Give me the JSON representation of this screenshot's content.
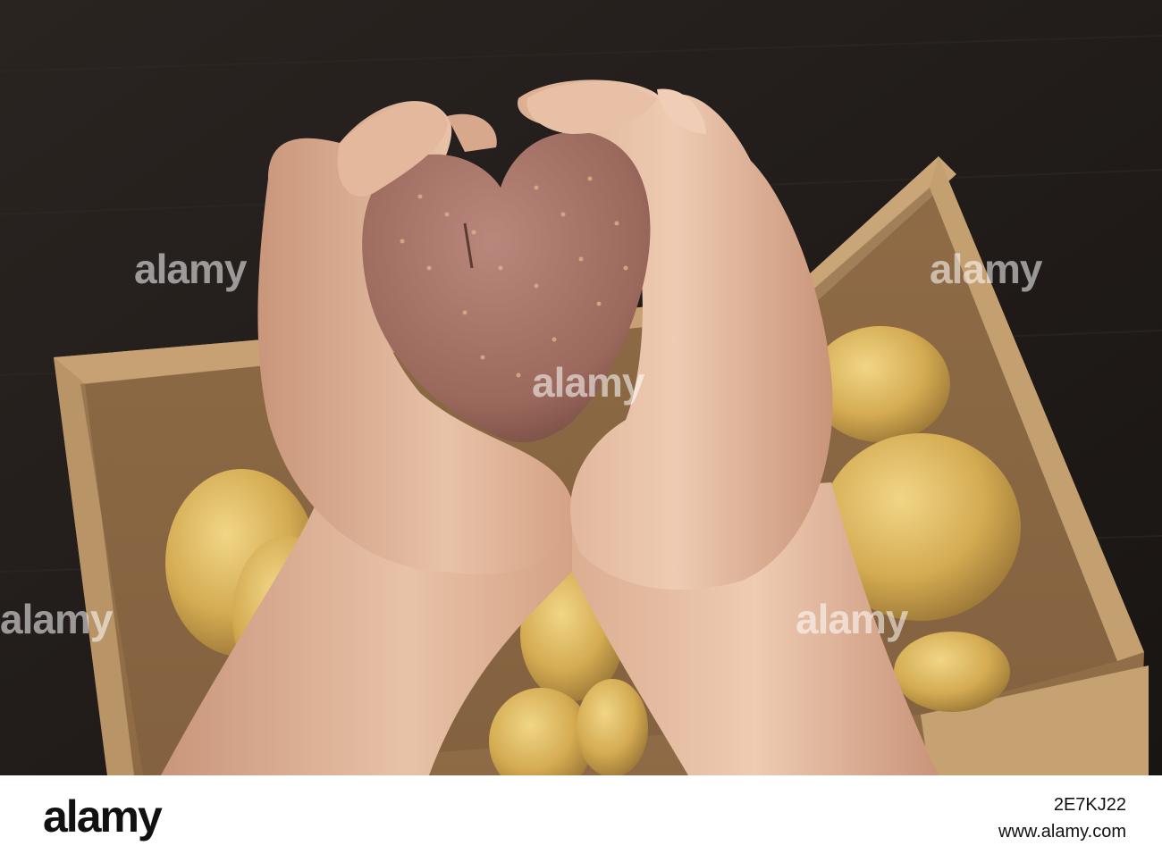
{
  "watermark": {
    "text": "alamy"
  },
  "footer": {
    "logo": "alamy",
    "image_id": "2E7KJ22",
    "site": "www.alamy.com"
  },
  "colors": {
    "background_wood": "#1f1a17",
    "cardboard": "#b58f62",
    "potato_yellow": "#d7b25b",
    "heart_potato": "#a6756a",
    "skin": "#e2b69c"
  }
}
